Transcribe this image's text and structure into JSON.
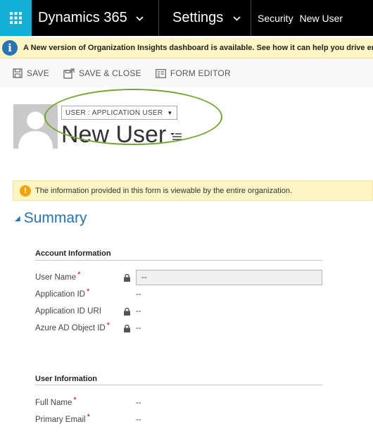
{
  "nav": {
    "app_name": "Dynamics 365",
    "area_name": "Settings",
    "breadcrumb": [
      "Security",
      "New User"
    ]
  },
  "notice": {
    "text": "A New version of Organization Insights dashboard is available. See how it can help you drive enc"
  },
  "toolbar": {
    "save_label": "SAVE",
    "save_close_label": "SAVE & CLOSE",
    "form_editor_label": "FORM EDITOR"
  },
  "header": {
    "form_selector": "USER : APPLICATION USER",
    "title": "New User"
  },
  "warning": {
    "text": "The information provided in this form is viewable by the entire organization."
  },
  "summary": {
    "title": "Summary",
    "account_info": {
      "title": "Account Information",
      "fields": [
        {
          "label": "User Name",
          "value": "--"
        },
        {
          "label": "Application ID",
          "value": "--"
        },
        {
          "label": "Application ID URI",
          "value": "--"
        },
        {
          "label": "Azure AD Object ID",
          "value": "--"
        }
      ]
    },
    "user_info": {
      "title": "User Information",
      "fields": [
        {
          "label": "Full Name",
          "value": "--"
        },
        {
          "label": "Primary Email",
          "value": "--"
        }
      ]
    }
  },
  "required_marker": "*",
  "colors": {
    "waffle": "#13b0d5",
    "accent_blue": "#2773b5",
    "notice_bg": "#fdf6c4",
    "highlight_green": "#73a534",
    "required_red": "#cc0000"
  }
}
